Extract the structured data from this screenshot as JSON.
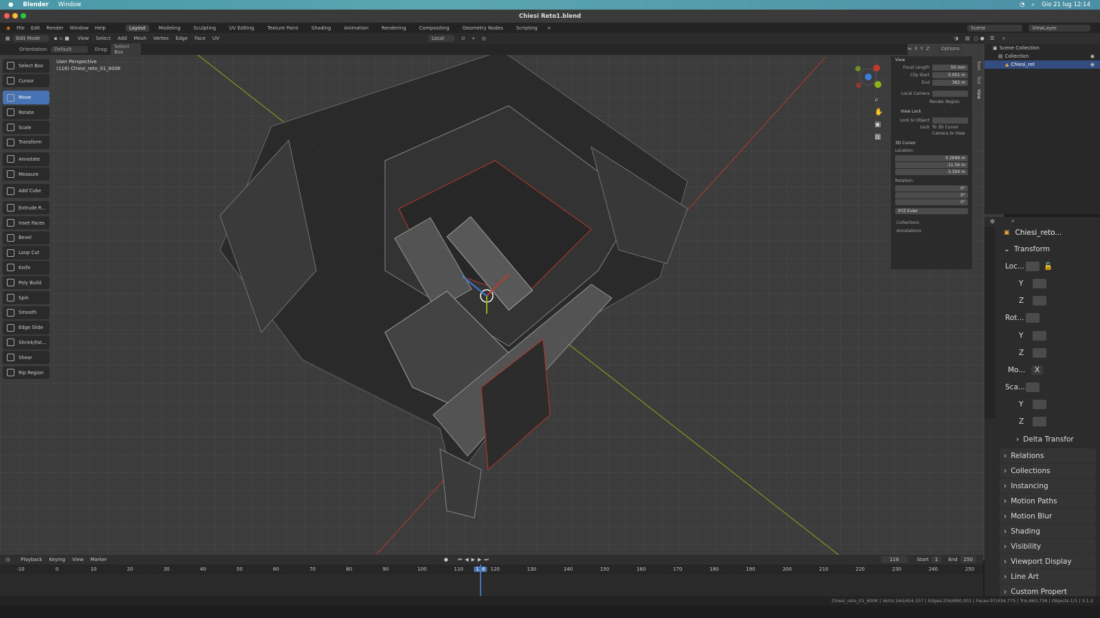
{
  "macbar": {
    "app": "Blender",
    "menu_window": "Window",
    "datetime": "Gio 21 lug  12:14"
  },
  "window": {
    "title": "Chiesi Reto1.blend"
  },
  "topmenu": {
    "file": "File",
    "edit": "Edit",
    "render": "Render",
    "window": "Window",
    "help": "Help",
    "tabs": [
      "Layout",
      "Modeling",
      "Sculpting",
      "UV Editing",
      "Texture Paint",
      "Shading",
      "Animation",
      "Rendering",
      "Compositing",
      "Geometry Nodes",
      "Scripting"
    ],
    "active_tab": "Layout",
    "scene": "Scene",
    "view_layer": "ViewLayer"
  },
  "header": {
    "mode": "Edit Mode",
    "menus": [
      "View",
      "Select",
      "Add",
      "Mesh",
      "Vertex",
      "Edge",
      "Face",
      "UV"
    ],
    "transform_space": "Local",
    "orientation_label": "Orientation:",
    "orientation_value": "Default",
    "drag_label": "Drag:",
    "drag_value": "Select Box",
    "options": "Options",
    "axes": [
      "X",
      "Y",
      "Z"
    ]
  },
  "viewport": {
    "perspective": "User Perspective",
    "object_info": "(116) Chiesi_reto_01_600K"
  },
  "toolbar": {
    "tools": [
      {
        "label": "Select Box",
        "icon": "select-box-icon"
      },
      {
        "label": "Cursor",
        "icon": "cursor-icon"
      },
      {
        "label": "Move",
        "icon": "move-icon",
        "active": true
      },
      {
        "label": "Rotate",
        "icon": "rotate-icon"
      },
      {
        "label": "Scale",
        "icon": "scale-icon"
      },
      {
        "label": "Transform",
        "icon": "transform-icon"
      },
      {
        "label": "Annotate",
        "icon": "annotate-icon"
      },
      {
        "label": "Measure",
        "icon": "measure-icon"
      },
      {
        "label": "Add Cube",
        "icon": "add-cube-icon"
      },
      {
        "label": "Extrude R...",
        "icon": "extrude-icon"
      },
      {
        "label": "Inset Faces",
        "icon": "inset-icon"
      },
      {
        "label": "Bevel",
        "icon": "bevel-icon"
      },
      {
        "label": "Loop Cut",
        "icon": "loop-cut-icon"
      },
      {
        "label": "Knife",
        "icon": "knife-icon"
      },
      {
        "label": "Poly Build",
        "icon": "poly-build-icon"
      },
      {
        "label": "Spin",
        "icon": "spin-icon"
      },
      {
        "label": "Smooth",
        "icon": "smooth-icon"
      },
      {
        "label": "Edge Slide",
        "icon": "edge-slide-icon"
      },
      {
        "label": "Shrink/Fat...",
        "icon": "shrink-icon"
      },
      {
        "label": "Shear",
        "icon": "shear-icon"
      },
      {
        "label": "Rip Region",
        "icon": "rip-icon"
      }
    ]
  },
  "npanel": {
    "view_title": "View",
    "focal_length_label": "Focal Length",
    "focal_length": "50 mm",
    "clip_start_label": "Clip Start",
    "clip_start": "0.001 m",
    "end_label": "End",
    "end": "362 m",
    "local_camera_label": "Local Camera",
    "render_region": "Render Region",
    "view_lock_title": "View Lock",
    "lock_to_object_label": "Lock to Object",
    "lock_label": "Lock",
    "to_3d_cursor": "To 3D Cursor",
    "camera_to_view": "Camera to View",
    "cursor_title": "3D Cursor",
    "location_label": "Location:",
    "loc_x": "0.2699 m",
    "loc_y": "-11.56 m",
    "loc_z": "-3.304 m",
    "rotation_label": "Rotation:",
    "rot_x": "0°",
    "rot_y": "0°",
    "rot_z": "0°",
    "rot_mode": "XYZ Euler",
    "collections": "Collections",
    "annotations": "Annotations",
    "tabs": [
      "Item",
      "Tool",
      "View"
    ]
  },
  "outliner": {
    "scene_collection": "Scene Collection",
    "collection": "Collection",
    "object": "Chiesi_ret"
  },
  "properties": {
    "object_name": "Chiesi_reto...",
    "transform_title": "Transform",
    "loc_label": "Loc...",
    "rot_label": "Rot...",
    "mode_label": "Mo...",
    "mode_value": "X",
    "scale_label": "Sca...",
    "y": "Y",
    "z": "Z",
    "delta": "Delta Transfor",
    "sections": [
      "Relations",
      "Collections",
      "Instancing",
      "Motion Paths",
      "Motion Blur",
      "Shading",
      "Visibility",
      "Viewport Display",
      "Line Art",
      "Custom Propert"
    ]
  },
  "timeline": {
    "playback": "Playback",
    "keying": "Keying",
    "view": "View",
    "marker": "Marker",
    "current": "116",
    "start_label": "Start",
    "start": "1",
    "end_label": "End",
    "end": "250",
    "ticks": [
      "-10",
      "0",
      "10",
      "20",
      "30",
      "40",
      "50",
      "60",
      "70",
      "80",
      "90",
      "100",
      "110",
      "116",
      "120",
      "130",
      "140",
      "150",
      "160",
      "170",
      "180",
      "190",
      "200",
      "210",
      "220",
      "230",
      "240",
      "250"
    ]
  },
  "statusbar": {
    "stats": "Chiesi_reto_01_600K | Verts:164/454,157 | Edges:256/890,001 | Faces:97/434,775 | Tris:863,736 | Objects:1/1 | 3.1.2"
  },
  "colors": {
    "accent": "#4772b3",
    "x_axis": "#c0392b",
    "y_axis": "#8db31a",
    "frame": "#4772b3"
  }
}
